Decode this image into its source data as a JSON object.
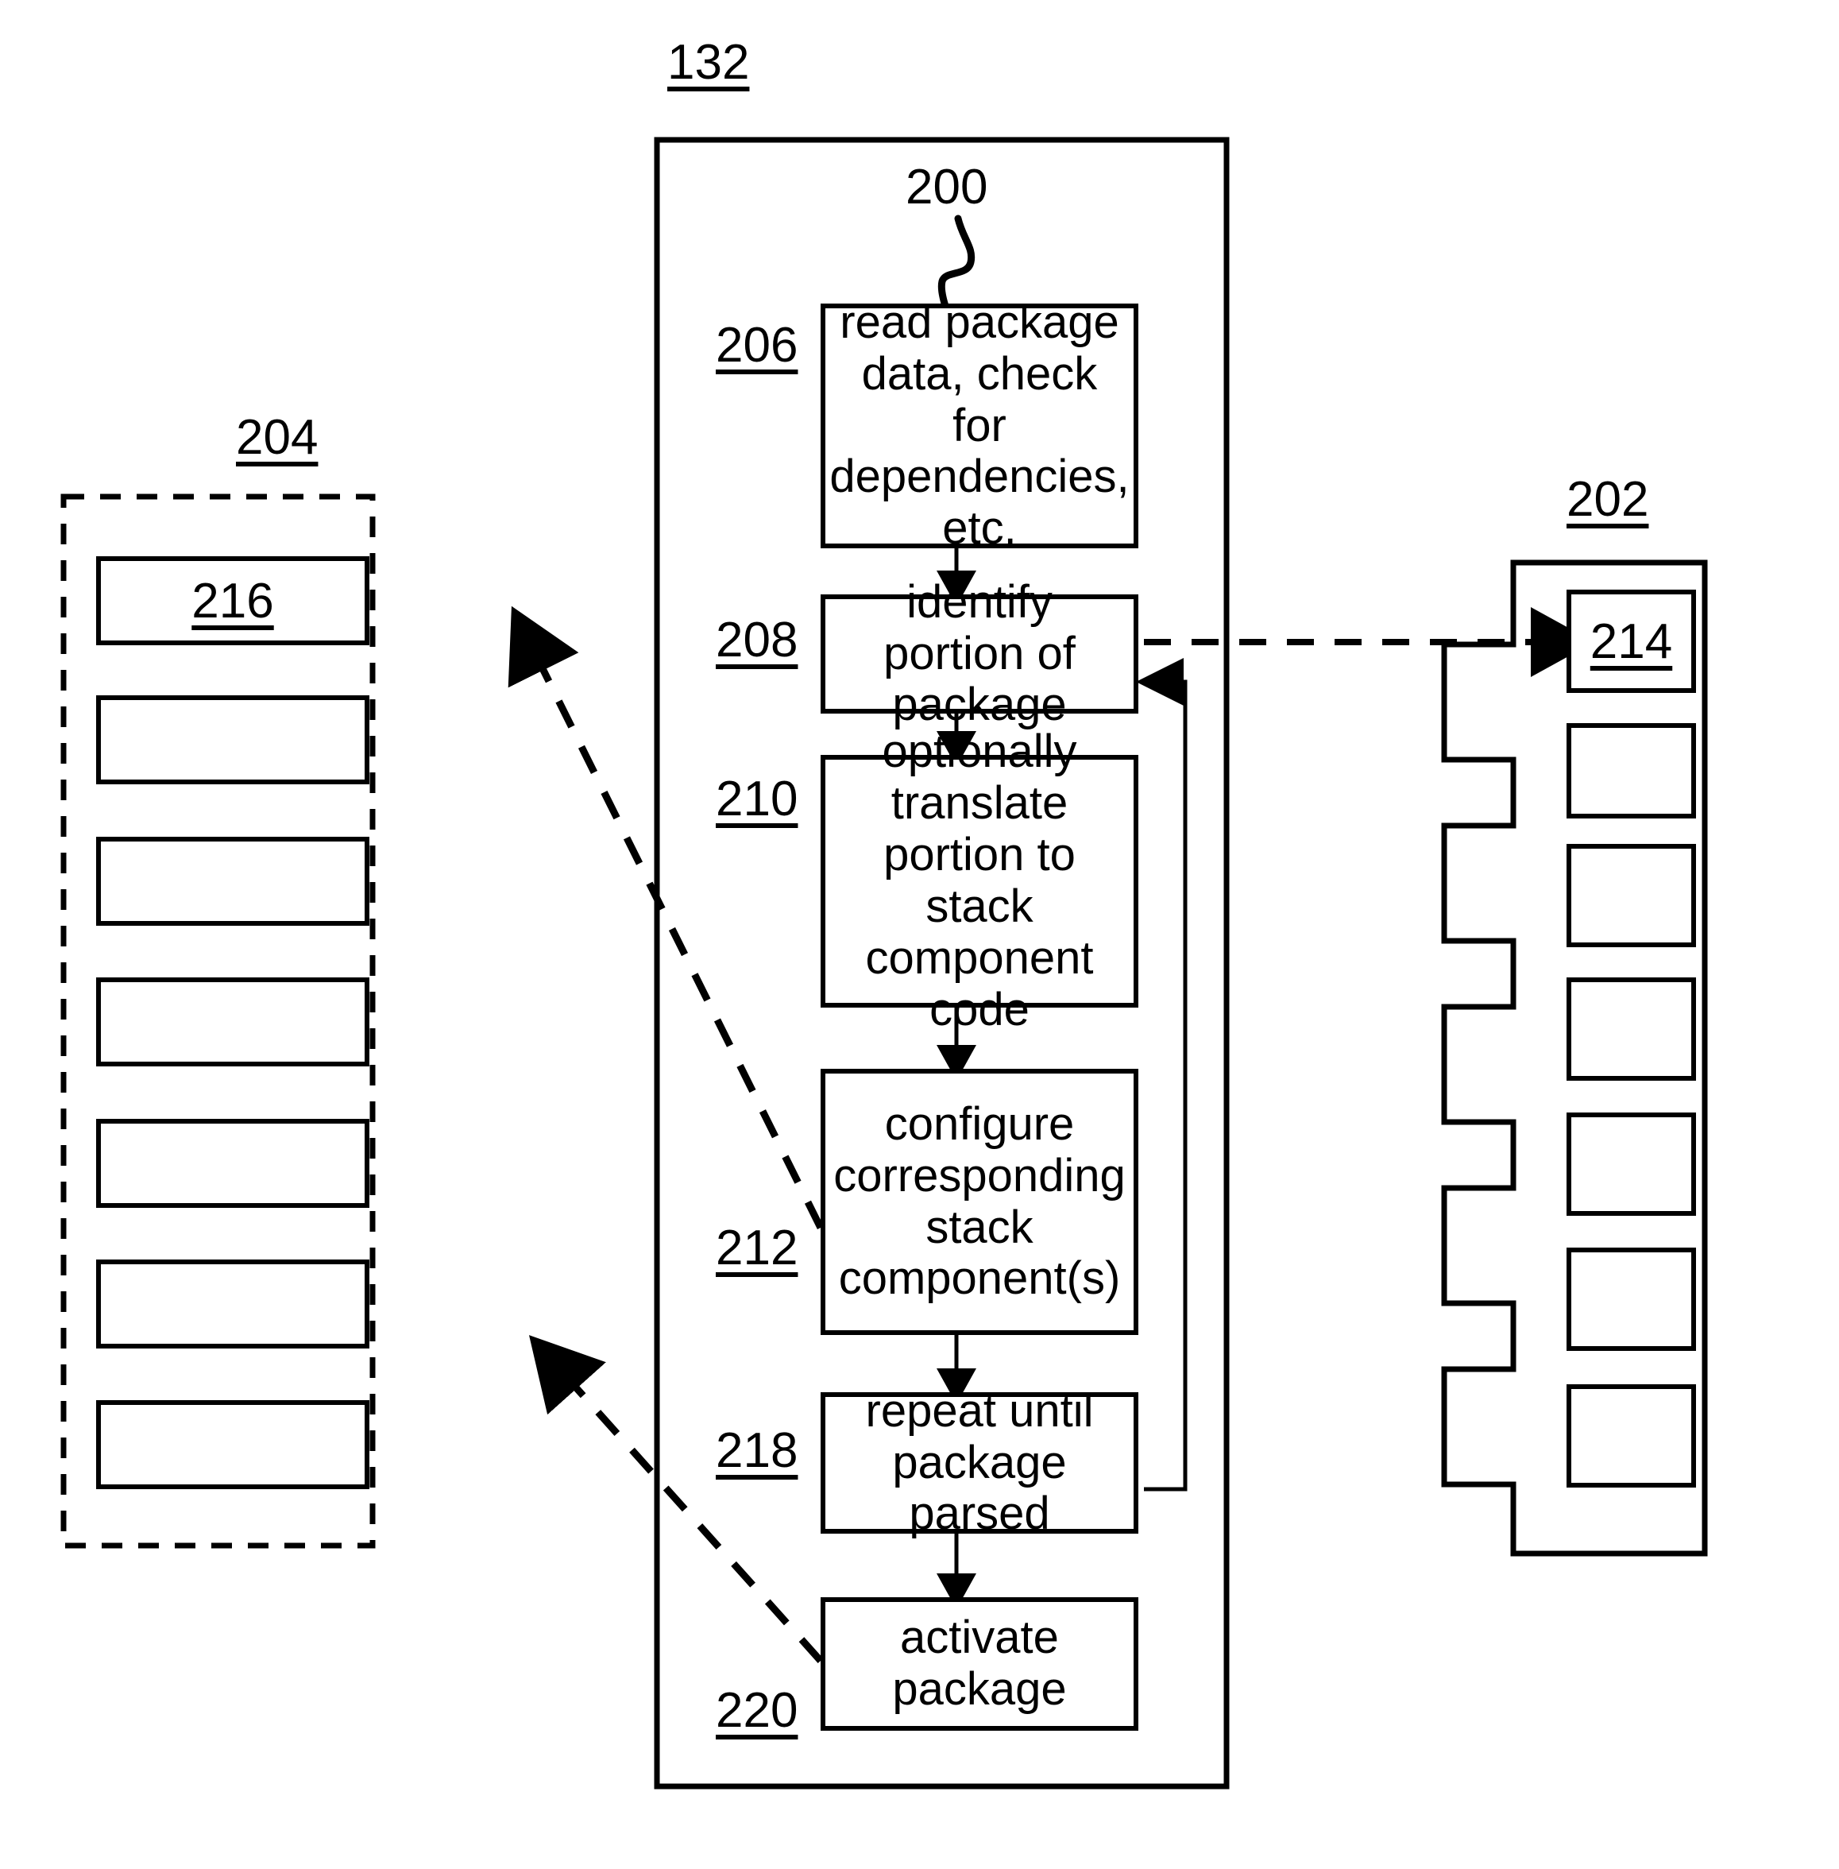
{
  "figure": {
    "title_ref": "132",
    "process_ref": "200",
    "memory_group_ref": "204",
    "stack_group_ref": "202",
    "highlight_memory_slot_ref": "216",
    "highlight_stack_slot_ref": "214"
  },
  "flow": {
    "steps": [
      {
        "ref": "206",
        "text": "read package data, check for dependencies, etc."
      },
      {
        "ref": "208",
        "text": "identify portion of package"
      },
      {
        "ref": "210",
        "text": "optionally translate portion to stack component code"
      },
      {
        "ref": "212",
        "text": "configure corresponding stack component(s)"
      },
      {
        "ref": "218",
        "text": "repeat until package parsed"
      },
      {
        "ref": "220",
        "text": "activate package"
      }
    ]
  },
  "memory_group": {
    "ref": "204",
    "slots": [
      {
        "label": "216"
      },
      {
        "label": ""
      },
      {
        "label": ""
      },
      {
        "label": ""
      },
      {
        "label": ""
      },
      {
        "label": ""
      },
      {
        "label": ""
      }
    ]
  },
  "stack_group": {
    "ref": "202",
    "slots": [
      {
        "label": "214"
      },
      {
        "label": ""
      },
      {
        "label": ""
      },
      {
        "label": ""
      },
      {
        "label": ""
      },
      {
        "label": ""
      },
      {
        "label": ""
      }
    ]
  },
  "connectors": {
    "solid_flow": "sequential down-arrows between flow steps",
    "feedback_loop": "repeat-until-parsed returns to identify-portion",
    "dashed_to_stack": "identify portion of package reads stack slot 214",
    "dashed_from_memory_216": "memory slot 216 feeds configure step 212",
    "dashed_from_memory_lower": "memory slot feeds activate package step 220"
  },
  "colors": {
    "stroke": "#000000",
    "background": "#ffffff"
  }
}
